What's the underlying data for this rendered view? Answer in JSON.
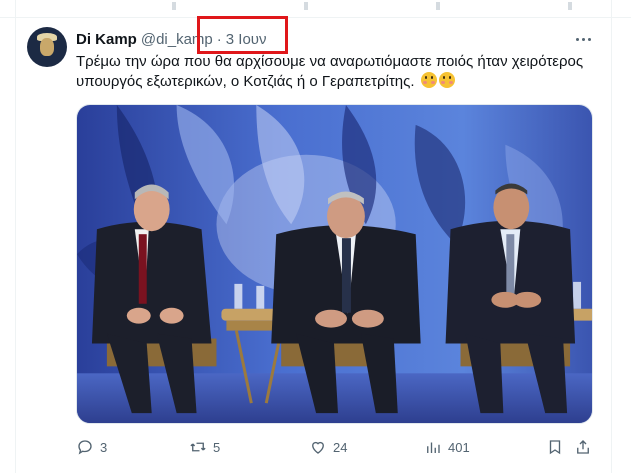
{
  "tweet": {
    "display_name": "Di Kamp",
    "handle": "@di_kamp",
    "separator": "·",
    "date": "3 Ιουν",
    "text": "Τρέμω την ώρα που θα αρχίσουμε να αναρωτιόμαστε ποιός ήταν χειρότερος υπουργός εξωτερικών, ο Κοτζιάς ή ο Γεραπετρίτης.",
    "emojis": [
      "flushed-face-emoji",
      "flushed-face-emoji"
    ]
  },
  "actions": {
    "replies": "3",
    "retweets": "5",
    "likes": "24",
    "views": "401"
  },
  "annotation": {
    "highlight_color": "#e0171a"
  },
  "colors": {
    "text_primary": "#0f1419",
    "text_secondary": "#536471",
    "divider": "#eff3f4"
  }
}
